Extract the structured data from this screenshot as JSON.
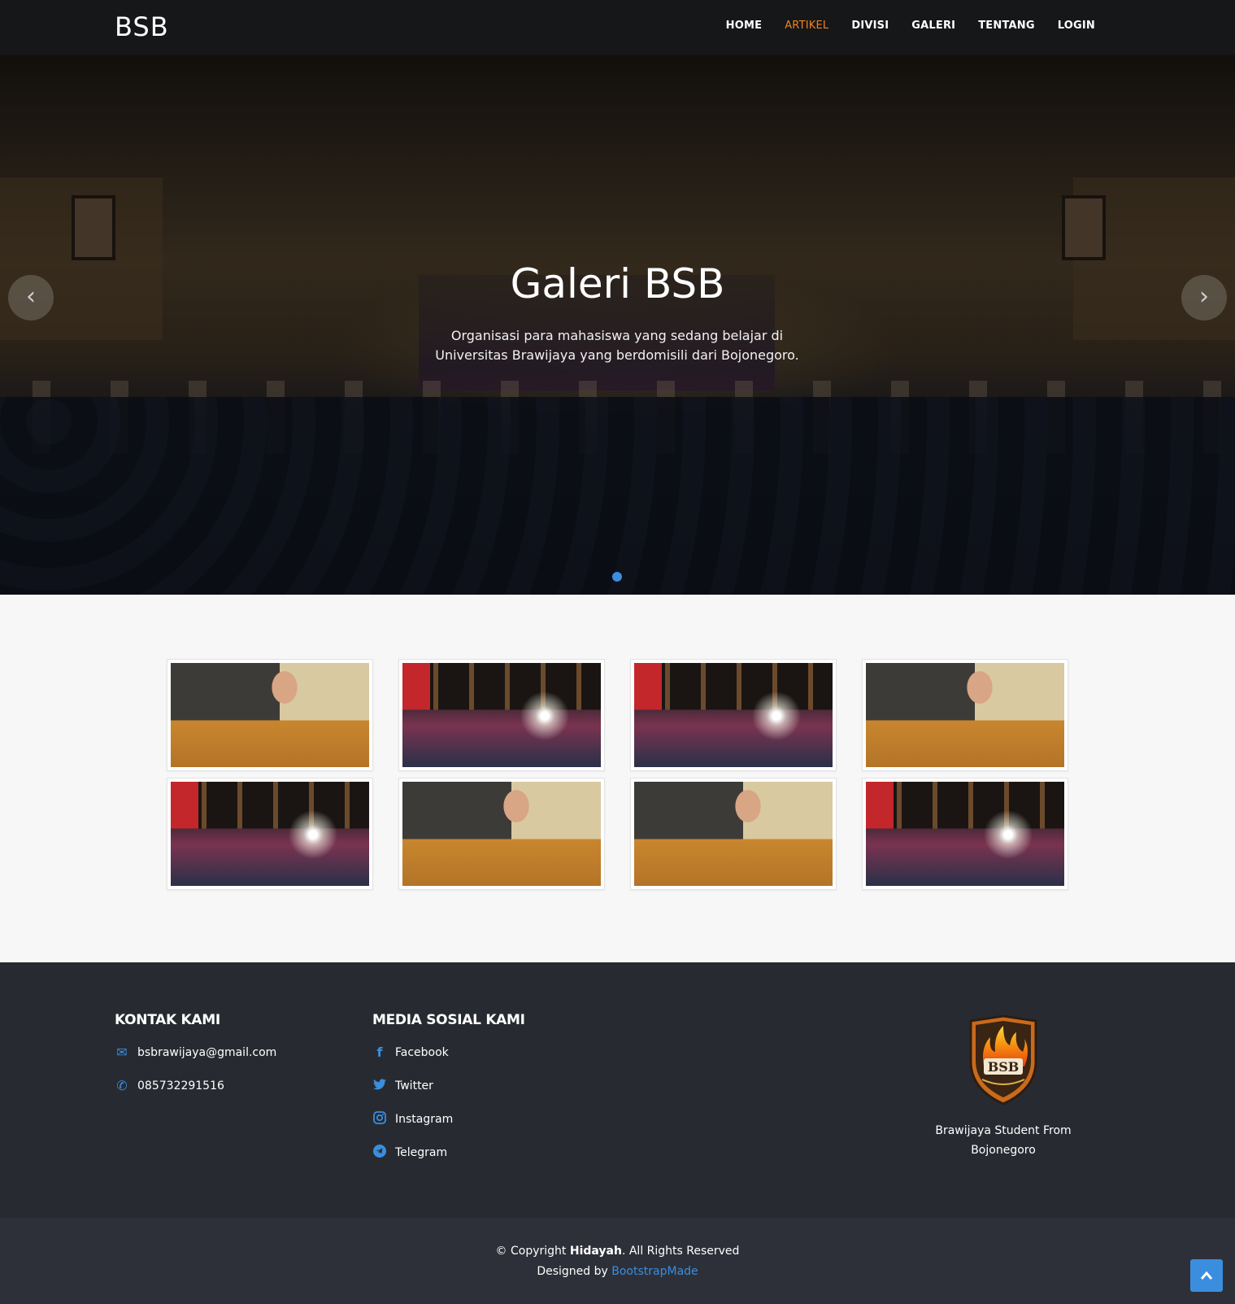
{
  "header": {
    "brand": "BSB",
    "menu": [
      {
        "label": "HOME",
        "active": false
      },
      {
        "label": "ARTIKEL",
        "active": true
      },
      {
        "label": "DIVISI",
        "active": false
      },
      {
        "label": "GALERI",
        "active": false
      },
      {
        "label": "TENTANG",
        "active": false
      },
      {
        "label": "LOGIN",
        "active": false
      }
    ]
  },
  "hero": {
    "title": "Galeri BSB",
    "subtitle": "Organisasi para mahasiswa yang sedang belajar di Universitas Brawijaya yang berdomisili dari Bojonegoro.",
    "prev_icon": "chevron-left-icon",
    "next_icon": "chevron-right-icon",
    "active_dot_color": "#3b8ede"
  },
  "gallery": {
    "images": [
      {
        "photo": "students-classroom"
      },
      {
        "photo": "night-gathering"
      },
      {
        "photo": "night-gathering"
      },
      {
        "photo": "students-classroom"
      },
      {
        "photo": "night-gathering"
      },
      {
        "photo": "students-classroom"
      },
      {
        "photo": "students-classroom"
      },
      {
        "photo": "night-gathering"
      }
    ]
  },
  "footer": {
    "contact": {
      "heading": "KONTAK KAMI",
      "email": "bsbrawijaya@gmail.com",
      "phone": "085732291516"
    },
    "social": {
      "heading": "MEDIA SOSIAL KAMI",
      "items": [
        {
          "label": "Facebook",
          "icon": "facebook-icon"
        },
        {
          "label": "Twitter",
          "icon": "twitter-icon"
        },
        {
          "label": "Instagram",
          "icon": "instagram-icon"
        },
        {
          "label": "Telegram",
          "icon": "telegram-icon"
        }
      ]
    },
    "logo": {
      "text": "BSB",
      "caption": "Brawijaya Student From Bojonegoro"
    }
  },
  "bottom": {
    "copy_prefix": "© Copyright ",
    "copy_name": "Hidayah",
    "copy_suffix": ". All Rights Reserved",
    "designed_prefix": "Designed by ",
    "designed_link": "BootstrapMade"
  },
  "colors": {
    "accent": "#3b8ede",
    "active_menu": "#f0821e",
    "footer_bg": "#272b31"
  }
}
